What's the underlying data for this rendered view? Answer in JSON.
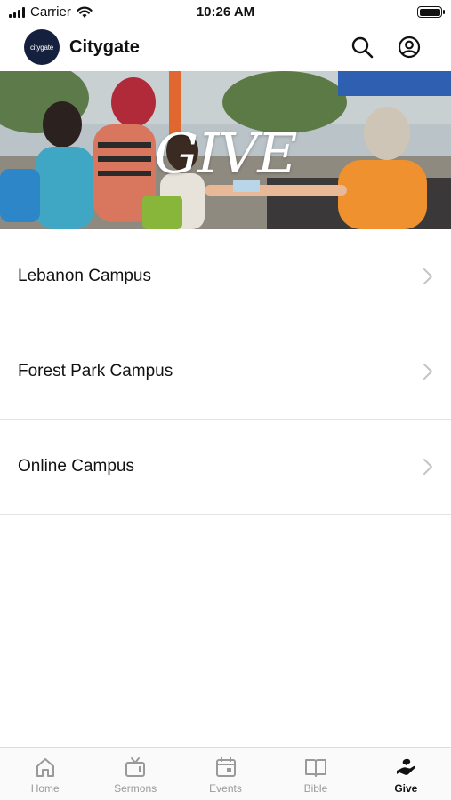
{
  "status_bar": {
    "carrier": "Carrier",
    "time": "10:26 AM"
  },
  "header": {
    "logo_text": "citygate",
    "title": "Citygate"
  },
  "hero": {
    "title": "GIVE"
  },
  "campuses": [
    {
      "label": "Lebanon Campus"
    },
    {
      "label": "Forest Park Campus"
    },
    {
      "label": "Online Campus"
    }
  ],
  "tabs": [
    {
      "label": "Home",
      "icon": "home-icon",
      "active": false
    },
    {
      "label": "Sermons",
      "icon": "tv-icon",
      "active": false
    },
    {
      "label": "Events",
      "icon": "calendar-icon",
      "active": false
    },
    {
      "label": "Bible",
      "icon": "book-icon",
      "active": false
    },
    {
      "label": "Give",
      "icon": "giving-hand-icon",
      "active": true
    }
  ],
  "colors": {
    "brand": "#14203d",
    "active_tab": "#111111",
    "inactive_tab": "#9a9a9a"
  }
}
